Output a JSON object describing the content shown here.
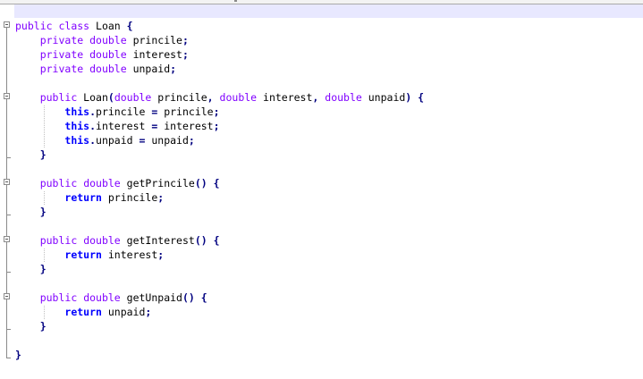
{
  "editor": {
    "lines": [
      [
        {
          "t": "public",
          "c": "kw"
        },
        {
          "t": " ",
          "c": "id"
        },
        {
          "t": "class",
          "c": "kw"
        },
        {
          "t": " Loan ",
          "c": "id"
        },
        {
          "t": "{",
          "c": "op"
        }
      ],
      [
        {
          "t": "    ",
          "c": "id"
        },
        {
          "t": "private",
          "c": "kw"
        },
        {
          "t": " ",
          "c": "id"
        },
        {
          "t": "double",
          "c": "kw"
        },
        {
          "t": " princile",
          "c": "id"
        },
        {
          "t": ";",
          "c": "op"
        }
      ],
      [
        {
          "t": "    ",
          "c": "id"
        },
        {
          "t": "private",
          "c": "kw"
        },
        {
          "t": " ",
          "c": "id"
        },
        {
          "t": "double",
          "c": "kw"
        },
        {
          "t": " interest",
          "c": "id"
        },
        {
          "t": ";",
          "c": "op"
        }
      ],
      [
        {
          "t": "    ",
          "c": "id"
        },
        {
          "t": "private",
          "c": "kw"
        },
        {
          "t": " ",
          "c": "id"
        },
        {
          "t": "double",
          "c": "kw"
        },
        {
          "t": " unpaid",
          "c": "id"
        },
        {
          "t": ";",
          "c": "op"
        }
      ],
      [],
      [
        {
          "t": "    ",
          "c": "id"
        },
        {
          "t": "public",
          "c": "kw"
        },
        {
          "t": " Loan",
          "c": "id"
        },
        {
          "t": "(",
          "c": "op"
        },
        {
          "t": "double",
          "c": "kw"
        },
        {
          "t": " princile",
          "c": "id"
        },
        {
          "t": ",",
          "c": "op"
        },
        {
          "t": " ",
          "c": "id"
        },
        {
          "t": "double",
          "c": "kw"
        },
        {
          "t": " interest",
          "c": "id"
        },
        {
          "t": ",",
          "c": "op"
        },
        {
          "t": " ",
          "c": "id"
        },
        {
          "t": "double",
          "c": "kw"
        },
        {
          "t": " unpaid",
          "c": "id"
        },
        {
          "t": ")",
          "c": "op"
        },
        {
          "t": " ",
          "c": "id"
        },
        {
          "t": "{",
          "c": "op"
        }
      ],
      [
        {
          "t": "        ",
          "c": "id"
        },
        {
          "t": "this",
          "c": "kwb"
        },
        {
          "t": ".",
          "c": "op"
        },
        {
          "t": "princile ",
          "c": "id"
        },
        {
          "t": "=",
          "c": "op"
        },
        {
          "t": " princile",
          "c": "id"
        },
        {
          "t": ";",
          "c": "op"
        }
      ],
      [
        {
          "t": "        ",
          "c": "id"
        },
        {
          "t": "this",
          "c": "kwb"
        },
        {
          "t": ".",
          "c": "op"
        },
        {
          "t": "interest ",
          "c": "id"
        },
        {
          "t": "=",
          "c": "op"
        },
        {
          "t": " interest",
          "c": "id"
        },
        {
          "t": ";",
          "c": "op"
        }
      ],
      [
        {
          "t": "        ",
          "c": "id"
        },
        {
          "t": "this",
          "c": "kwb"
        },
        {
          "t": ".",
          "c": "op"
        },
        {
          "t": "unpaid ",
          "c": "id"
        },
        {
          "t": "=",
          "c": "op"
        },
        {
          "t": " unpaid",
          "c": "id"
        },
        {
          "t": ";",
          "c": "op"
        }
      ],
      [
        {
          "t": "    ",
          "c": "id"
        },
        {
          "t": "}",
          "c": "op"
        }
      ],
      [],
      [
        {
          "t": "    ",
          "c": "id"
        },
        {
          "t": "public",
          "c": "kw"
        },
        {
          "t": " ",
          "c": "id"
        },
        {
          "t": "double",
          "c": "kw"
        },
        {
          "t": " getPrincile",
          "c": "id"
        },
        {
          "t": "()",
          "c": "op"
        },
        {
          "t": " ",
          "c": "id"
        },
        {
          "t": "{",
          "c": "op"
        }
      ],
      [
        {
          "t": "        ",
          "c": "id"
        },
        {
          "t": "return",
          "c": "kwb"
        },
        {
          "t": " princile",
          "c": "id"
        },
        {
          "t": ";",
          "c": "op"
        }
      ],
      [
        {
          "t": "    ",
          "c": "id"
        },
        {
          "t": "}",
          "c": "op"
        }
      ],
      [],
      [
        {
          "t": "    ",
          "c": "id"
        },
        {
          "t": "public",
          "c": "kw"
        },
        {
          "t": " ",
          "c": "id"
        },
        {
          "t": "double",
          "c": "kw"
        },
        {
          "t": " getInterest",
          "c": "id"
        },
        {
          "t": "()",
          "c": "op"
        },
        {
          "t": " ",
          "c": "id"
        },
        {
          "t": "{",
          "c": "op"
        }
      ],
      [
        {
          "t": "        ",
          "c": "id"
        },
        {
          "t": "return",
          "c": "kwb"
        },
        {
          "t": " interest",
          "c": "id"
        },
        {
          "t": ";",
          "c": "op"
        }
      ],
      [
        {
          "t": "    ",
          "c": "id"
        },
        {
          "t": "}",
          "c": "op"
        }
      ],
      [],
      [
        {
          "t": "    ",
          "c": "id"
        },
        {
          "t": "public",
          "c": "kw"
        },
        {
          "t": " ",
          "c": "id"
        },
        {
          "t": "double",
          "c": "kw"
        },
        {
          "t": " getUnpaid",
          "c": "id"
        },
        {
          "t": "()",
          "c": "op"
        },
        {
          "t": " ",
          "c": "id"
        },
        {
          "t": "{",
          "c": "op"
        }
      ],
      [
        {
          "t": "        ",
          "c": "id"
        },
        {
          "t": "return",
          "c": "kwb"
        },
        {
          "t": " unpaid",
          "c": "id"
        },
        {
          "t": ";",
          "c": "op"
        }
      ],
      [
        {
          "t": "    ",
          "c": "id"
        },
        {
          "t": "}",
          "c": "op"
        }
      ],
      [],
      [
        {
          "t": "}",
          "c": "op"
        }
      ]
    ]
  },
  "colors": {
    "keyword": "#8000ff",
    "keyword_bold": "#0000ff",
    "identifier": "#000000",
    "operator": "#000080",
    "current_line": "#e8e8ff"
  }
}
